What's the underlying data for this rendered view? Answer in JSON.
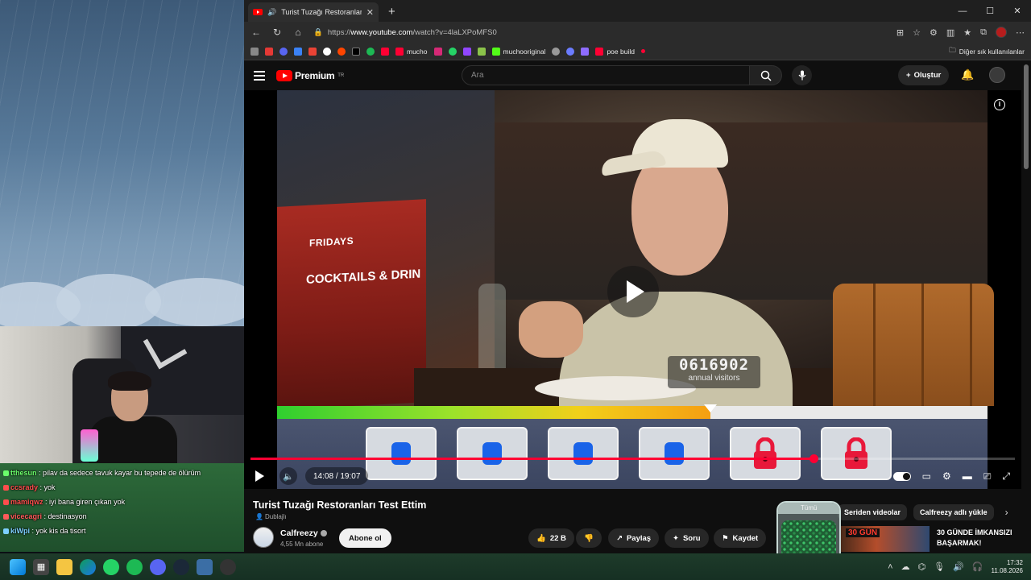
{
  "browser": {
    "tab_title": "Turist Tuzağı Restoranları Test",
    "url_prefix": "https://",
    "url_domain": "www.youtube.com",
    "url_path": "/watch?v=4laLXPoMFS0",
    "bookmarks": [
      {
        "label": "mucho",
        "color": "#ff0033"
      },
      {
        "label": "muchooriginal",
        "color": "#53fc18"
      },
      {
        "label": "poe build",
        "color": "#ff0033"
      }
    ],
    "other_bookmarks": "Diğer sık kullanılanlar"
  },
  "youtube": {
    "logo_text": "Premium",
    "logo_region": "TR",
    "search_placeholder": "Ara",
    "create_label": "Oluştur"
  },
  "player": {
    "counter_value": "0616902",
    "counter_label": "annual visitors",
    "time_current": "14:08",
    "time_total": "19:07",
    "time_separator": "/",
    "progress_fraction": 0.737,
    "gradient_fraction": 0.61,
    "menu_brand": "FRIDAYS",
    "menu_text": "COCKTAILS & DRIN",
    "items": [
      {
        "name": "cloth-item",
        "color": "#1a63e8",
        "locked": false
      },
      {
        "name": "cheese-item",
        "color": "#1a63e8",
        "locked": false
      },
      {
        "name": "guitar-item",
        "color": "#1a63e8",
        "locked": false
      },
      {
        "name": "fish-item",
        "color": "#1a63e8",
        "locked": false
      },
      {
        "name": "locked-item",
        "color": "#e8183a",
        "locked": true
      },
      {
        "name": "locked-item",
        "color": "#e8183a",
        "locked": true
      }
    ]
  },
  "video": {
    "title": "Turist Tuzağı Restoranları Test Ettim",
    "dubbed_label": "Dublajlı",
    "channel_name": "Calfreezy",
    "subscribers": "4,55 Mn abone",
    "subscribe_label": "Abone ol",
    "like_count": "22 B",
    "share_label": "Paylaş",
    "ask_label": "Soru",
    "save_label": "Kaydet"
  },
  "sidebar": {
    "chips": [
      {
        "label": "Tümü",
        "active": true
      },
      {
        "label": "Seriden videolar",
        "active": false
      },
      {
        "label": "Calfreezy adlı yükle",
        "active": false
      }
    ],
    "suggestion_thumb_text": "30 GÜN",
    "suggestion_title": "30 GÜNDE İMKANSIZI BAŞARMAK!"
  },
  "chat": [
    {
      "user": "tthesun",
      "color": "#6bff6b",
      "message": "pilav da sedece tavuk kayar bu tepede de ölürüm"
    },
    {
      "user": "ccsrady",
      "color": "#ff4d4d",
      "message": "yok"
    },
    {
      "user": "mamiqwz",
      "color": "#ff4d4d",
      "message": "iyi bana giren çıkan yok"
    },
    {
      "user": "vicecagri",
      "color": "#ff5a5a",
      "message": "destinasyon"
    },
    {
      "user": "kiWpi",
      "color": "#7dd0ff",
      "message": "yok kis da tisort"
    }
  ],
  "taskbar": {
    "time": "17:32",
    "date": "11.08.2026"
  }
}
